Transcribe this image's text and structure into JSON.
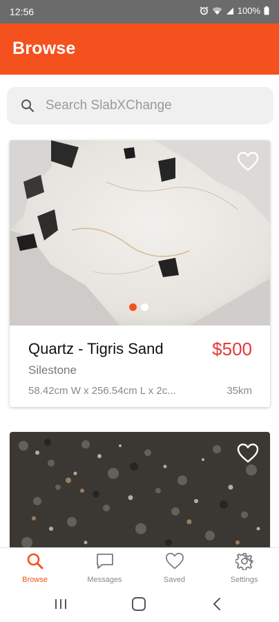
{
  "status_bar": {
    "time": "12:56",
    "battery": "100%",
    "icons": [
      "alarm-icon",
      "wifi-icon",
      "signal-icon",
      "battery-icon"
    ]
  },
  "app_bar": {
    "title": "Browse",
    "color": "#f4511e"
  },
  "search": {
    "placeholder": "Search SlabXChange",
    "value": ""
  },
  "listings": [
    {
      "title": "Quartz - Tigris Sand",
      "price": "$500",
      "brand": "Silestone",
      "dimensions": "58.42cm W x 256.54cm L x 2c...",
      "distance": "35km",
      "favorite": false,
      "image_count": 2,
      "active_image": 1
    },
    {
      "favorite": false
    }
  ],
  "bottom_nav": [
    {
      "label": "Browse",
      "icon": "search-icon",
      "active": true
    },
    {
      "label": "Messages",
      "icon": "chat-bubble-icon",
      "active": false
    },
    {
      "label": "Saved",
      "icon": "heart-icon",
      "active": false
    },
    {
      "label": "Settings",
      "icon": "gear-icon",
      "active": false
    }
  ],
  "colors": {
    "accent": "#f4511e",
    "price": "#e53935"
  }
}
